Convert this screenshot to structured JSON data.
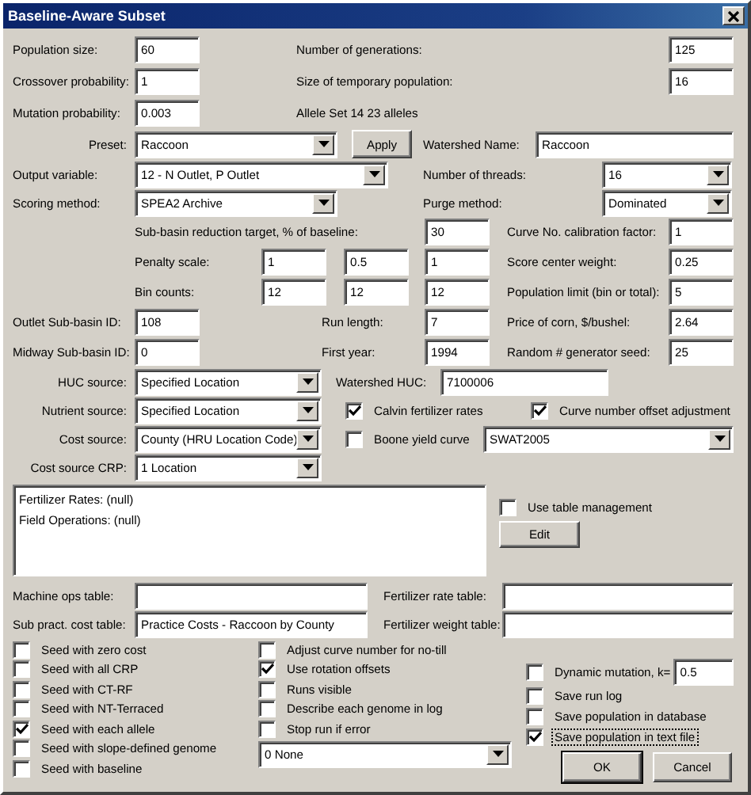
{
  "window": {
    "title": "Baseline-Aware Subset"
  },
  "population_size": {
    "label": "Population size:",
    "value": "60"
  },
  "generations": {
    "label": "Number of generations:",
    "value": "125"
  },
  "crossover": {
    "label": "Crossover probability:",
    "value": "1"
  },
  "temp_population": {
    "label": "Size of temporary population:",
    "value": "16"
  },
  "mutation": {
    "label": "Mutation probability:",
    "value": "0.003"
  },
  "allele_info": "Allele Set 14 23 alleles",
  "preset": {
    "label": "Preset:",
    "value": "Raccoon"
  },
  "apply_button": "Apply",
  "watershed_name": {
    "label": "Watershed Name:",
    "value": "Raccoon"
  },
  "output_variable": {
    "label": "Output variable:",
    "value": "12 - N Outlet, P Outlet"
  },
  "threads": {
    "label": "Number of threads:",
    "value": "16"
  },
  "scoring": {
    "label": "Scoring method:",
    "value": "SPEA2 Archive"
  },
  "purge": {
    "label": "Purge method:",
    "value": "Dominated"
  },
  "reduction_target": {
    "label": "Sub-basin reduction target, % of baseline:",
    "value": "30"
  },
  "calibration": {
    "label": "Curve No. calibration factor:",
    "value": "1"
  },
  "penalty_scale": {
    "label": "Penalty scale:",
    "values": [
      "1",
      "0.5",
      "1"
    ]
  },
  "score_center": {
    "label": "Score center weight:",
    "value": "0.25"
  },
  "bin_counts": {
    "label": "Bin counts:",
    "values": [
      "12",
      "12",
      "12"
    ]
  },
  "population_limit": {
    "label": "Population limit (bin or total):",
    "value": "5"
  },
  "outlet": {
    "label": "Outlet Sub-basin ID:",
    "value": "108"
  },
  "run_length": {
    "label": "Run length:",
    "value": "7"
  },
  "corn_price": {
    "label": "Price of corn, $/bushel:",
    "value": "2.64"
  },
  "midway": {
    "label": "Midway Sub-basin ID:",
    "value": "0"
  },
  "first_year": {
    "label": "First year:",
    "value": "1994"
  },
  "seed": {
    "label": "Random # generator seed:",
    "value": "25"
  },
  "huc_source": {
    "label": "HUC source:",
    "value": "Specified Location"
  },
  "watershed_huc": {
    "label": "Watershed HUC:",
    "value": "7100006"
  },
  "nutrient_source": {
    "label": "Nutrient source:",
    "value": "Specified Location"
  },
  "calvin": {
    "label": "Calvin fertilizer rates",
    "checked": true
  },
  "curve_offset": {
    "label": "Curve number offset adjustment",
    "checked": true
  },
  "cost_source": {
    "label": "Cost source:",
    "value": "County (HRU Location Code)"
  },
  "boone": {
    "label": "Boone yield curve",
    "checked": false
  },
  "swat_version": {
    "value": "SWAT2005"
  },
  "cost_source_crp": {
    "label": "Cost source CRP:",
    "value": "1 Location"
  },
  "management_text": [
    "Fertilizer Rates: (null)",
    "Field Operations: (null)"
  ],
  "table_management": {
    "label": "Use table management",
    "checked": false
  },
  "edit_button": "Edit",
  "machine_ops": {
    "label": "Machine ops table:"
  },
  "fertilizer_rate": {
    "label": "Fertilizer rate table:"
  },
  "sub_pract": {
    "label": "Sub pract. cost table:",
    "value": "Practice Costs - Raccoon by County"
  },
  "fertilizer_weight": {
    "label": "Fertilizer weight table:"
  },
  "seed_options": [
    {
      "label": "Seed with zero cost",
      "checked": false
    },
    {
      "label": "Seed with all CRP",
      "checked": false
    },
    {
      "label": "Seed with CT-RF",
      "checked": false
    },
    {
      "label": "Seed with NT-Terraced",
      "checked": false
    },
    {
      "label": "Seed with each allele",
      "checked": true
    },
    {
      "label": "Seed with slope-defined genome",
      "checked": false
    },
    {
      "label": "Seed with baseline",
      "checked": false
    }
  ],
  "run_options": [
    {
      "label": "Adjust curve number for no-till",
      "checked": false
    },
    {
      "label": "Use rotation offsets",
      "checked": true
    },
    {
      "label": "Runs visible",
      "checked": false
    },
    {
      "label": "Describe each genome in log",
      "checked": false
    },
    {
      "label": "Stop run if error",
      "checked": false
    }
  ],
  "log_level": {
    "value": "0 None"
  },
  "dynamic_mutation": {
    "label": "Dynamic mutation, k=",
    "checked": false,
    "value": "0.5"
  },
  "save_options": [
    {
      "label": "Save run log",
      "checked": false,
      "focused": false
    },
    {
      "label": "Save population in database",
      "checked": false,
      "focused": false
    },
    {
      "label": "Save population in text file",
      "checked": true,
      "focused": true
    }
  ],
  "buttons": [
    "OK",
    "Cancel"
  ]
}
